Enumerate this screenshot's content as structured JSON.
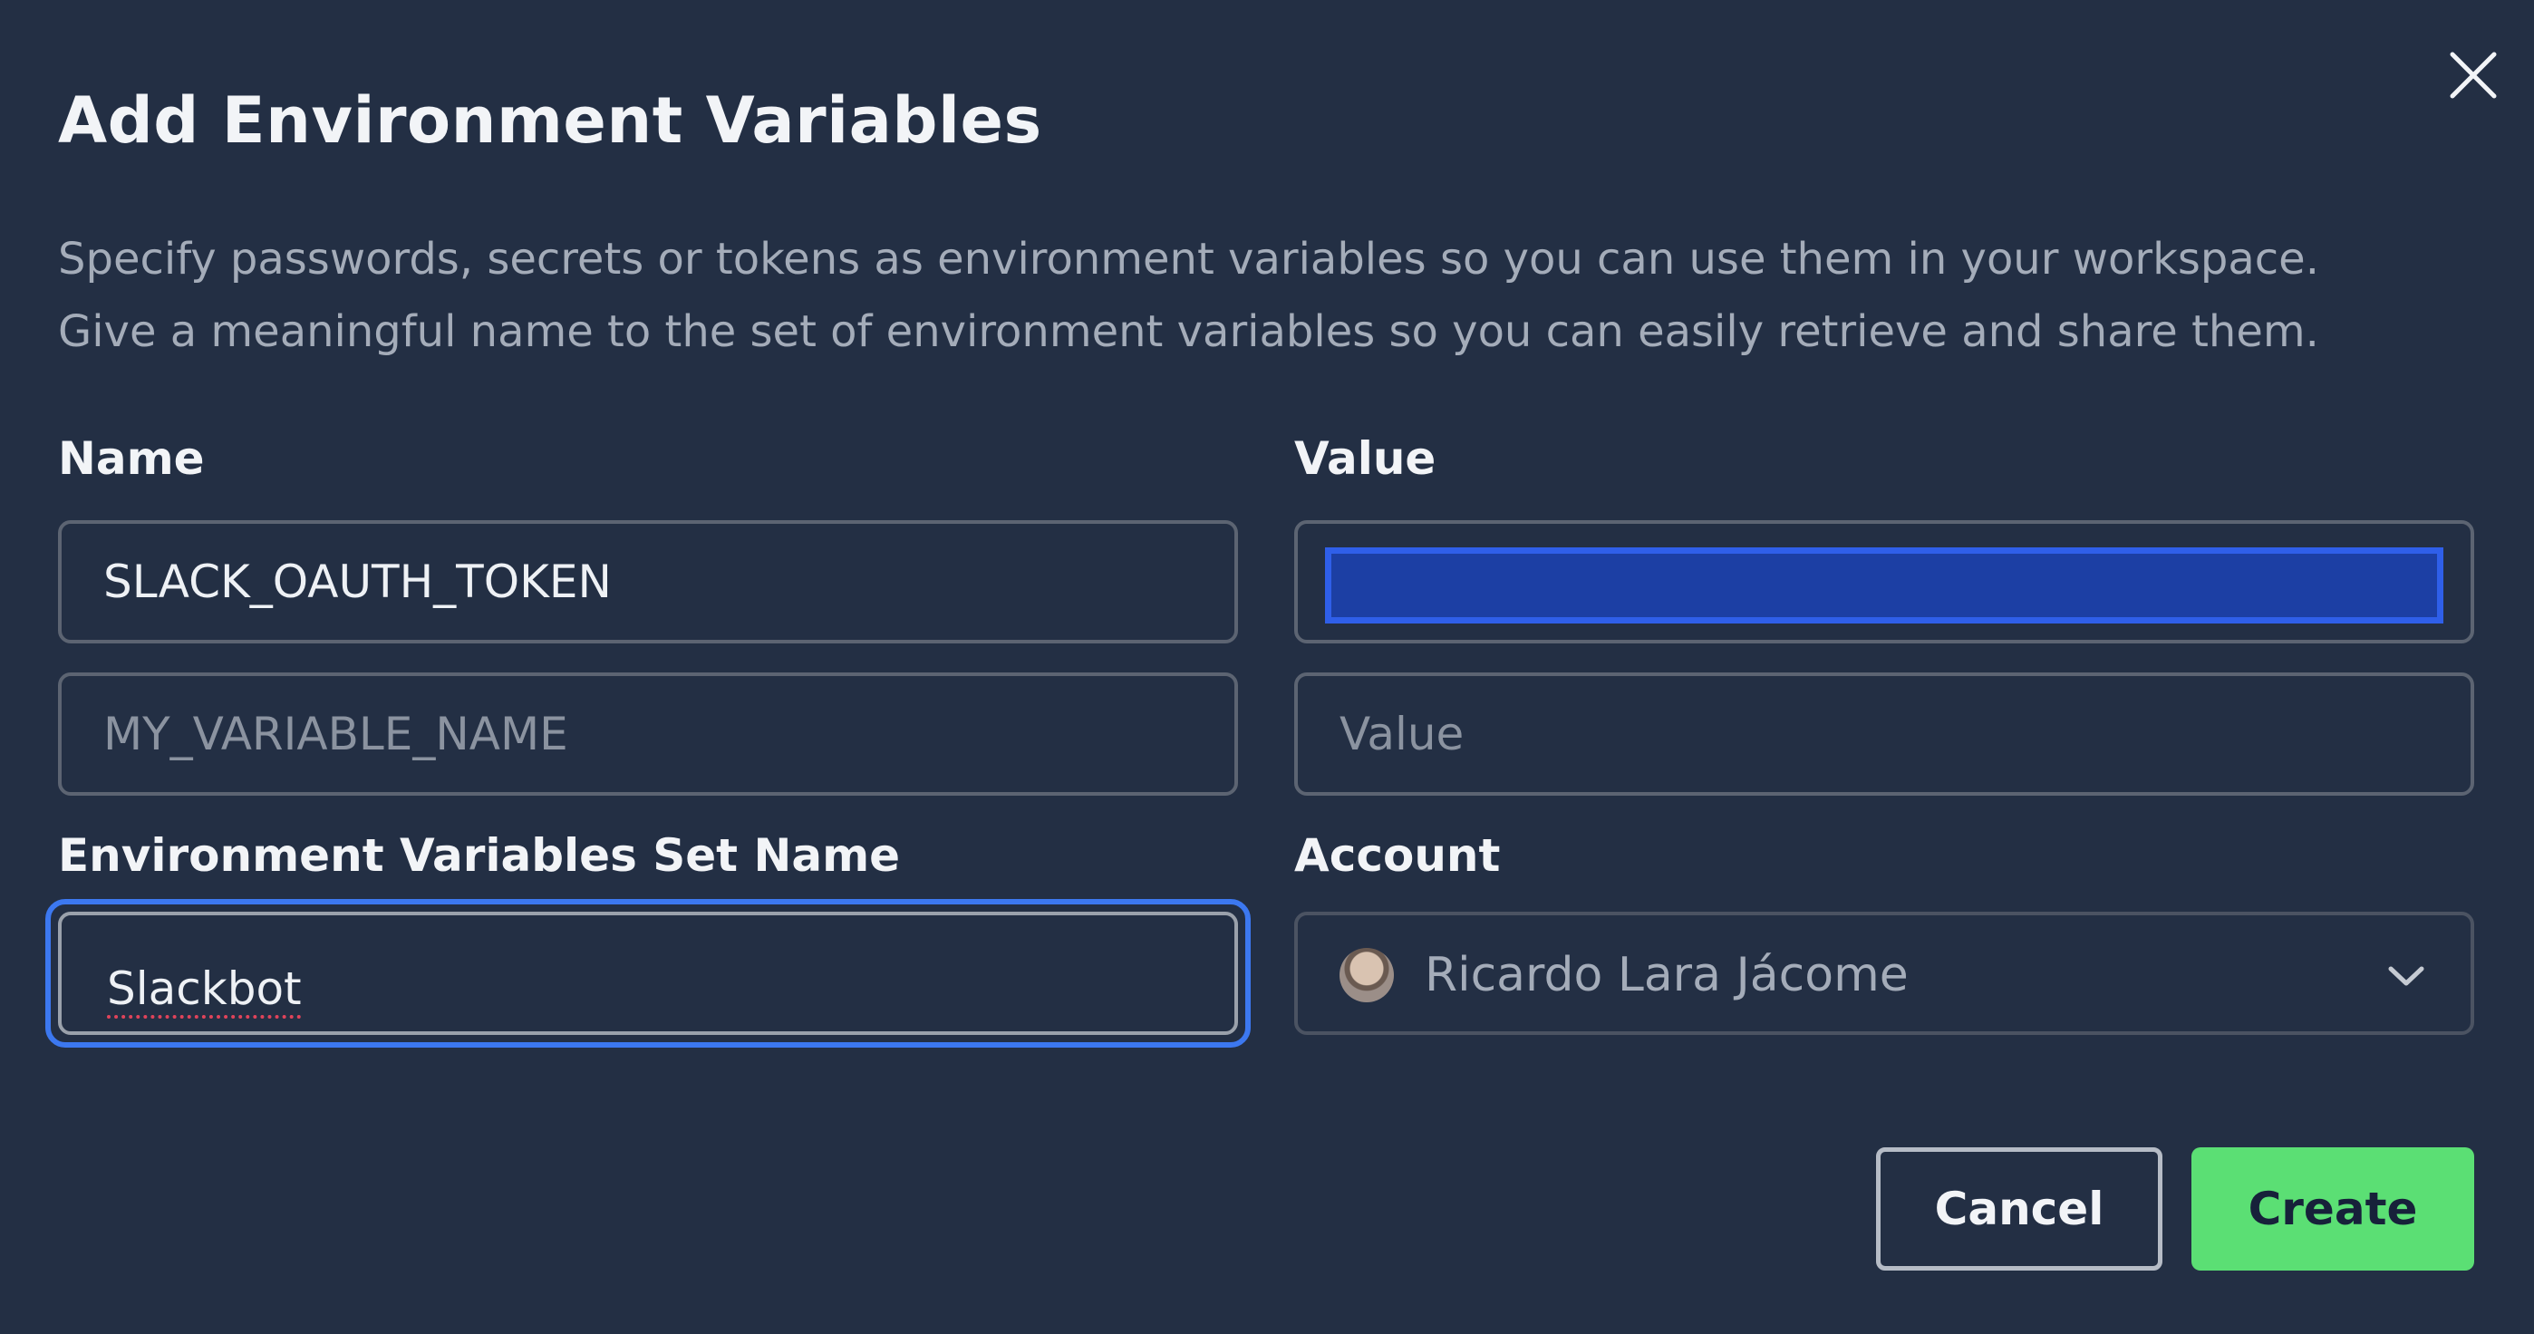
{
  "dialog": {
    "title": "Add Environment Variables",
    "description_line1": "Specify passwords, secrets or tokens as environment variables so you can use them in your workspace.",
    "description_line2": "Give a meaningful name to the set of environment variables so you can easily retrieve and share them."
  },
  "variables": {
    "name_label": "Name",
    "value_label": "Value",
    "rows": [
      {
        "name": "SLACK_OAUTH_TOKEN",
        "value_masked": true
      },
      {
        "name": "",
        "name_placeholder": "MY_VARIABLE_NAME",
        "value": "",
        "value_placeholder": "Value"
      }
    ]
  },
  "set_name": {
    "label": "Environment Variables Set Name",
    "value": "Slackbot"
  },
  "account": {
    "label": "Account",
    "selected": "Ricardo Lara Jácome"
  },
  "actions": {
    "cancel_label": "Cancel",
    "create_label": "Create"
  },
  "colors": {
    "background": "#232f44",
    "accent_focus": "#3c78f0",
    "create_button": "#5bdf74",
    "masked_value": "#1c3fa4"
  },
  "icons": {
    "close": "close-icon",
    "dropdown": "chevron-down-icon",
    "avatar": "user-avatar"
  }
}
